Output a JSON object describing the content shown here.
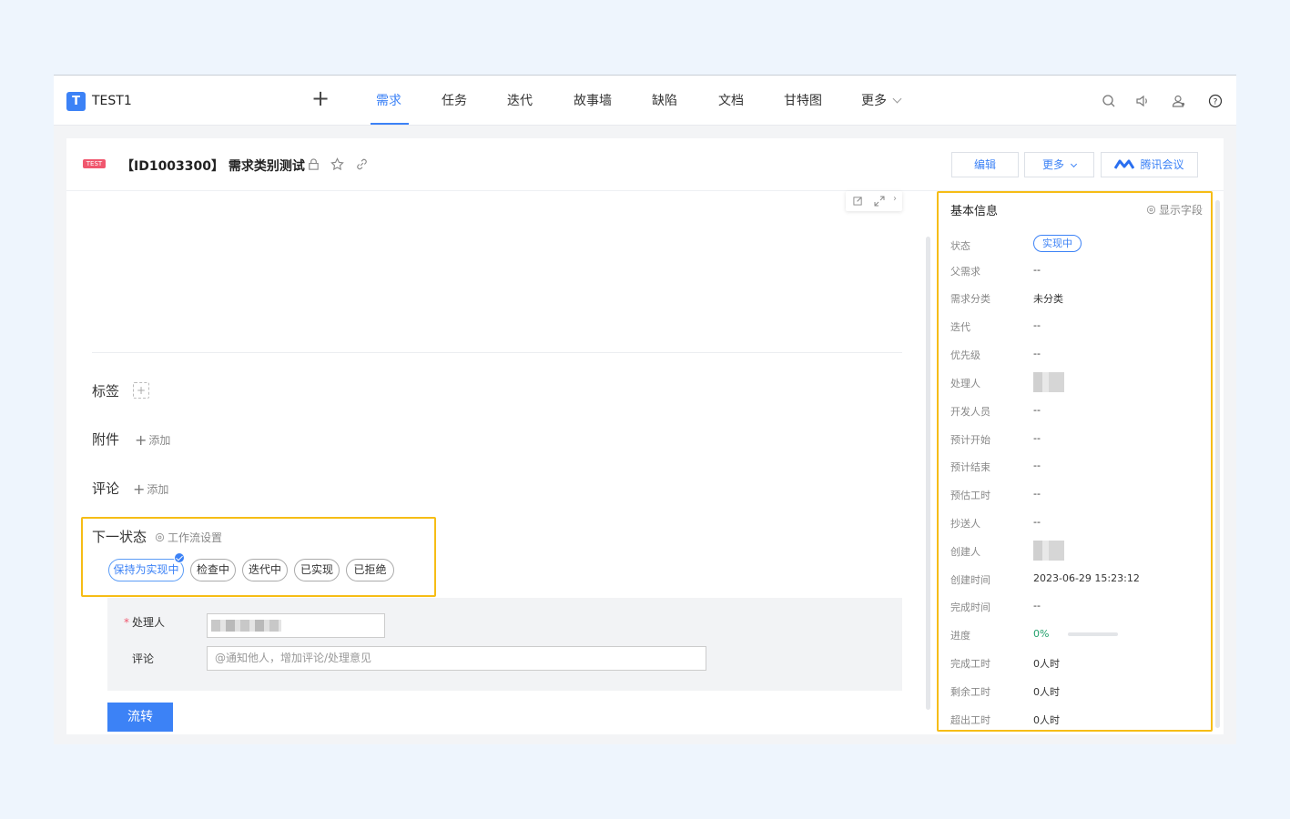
{
  "project": {
    "logo_letter": "T",
    "name": "TEST1"
  },
  "nav": {
    "add": "+",
    "items": [
      {
        "label": "需求",
        "active": true
      },
      {
        "label": "任务"
      },
      {
        "label": "迭代"
      },
      {
        "label": "故事墙"
      },
      {
        "label": "缺陷"
      },
      {
        "label": "文档"
      },
      {
        "label": "甘特图"
      },
      {
        "label": "更多"
      }
    ]
  },
  "toolbar_icons": [
    "search-icon",
    "speaker-icon",
    "user-icon",
    "help-icon"
  ],
  "detail": {
    "badge": "TEST",
    "title": "【ID1003300】 需求类别测试",
    "edit_btn": "编辑",
    "more_btn": "更多",
    "meeting_btn": "腾讯会议"
  },
  "sections": {
    "tags": "标签",
    "tags_add": "+",
    "attachments": "附件",
    "comments": "评论",
    "add": "添加"
  },
  "next_state": {
    "title": "下一状态",
    "workflow_setting": "工作流设置",
    "states": [
      "保持为实现中",
      "检查中",
      "迭代中",
      "已实现",
      "已拒绝"
    ],
    "selected_index": 0
  },
  "form": {
    "assignee_label": "处理人",
    "comment_label": "评论",
    "comment_placeholder": "@通知他人，增加评论/处理意见",
    "submit": "流转"
  },
  "side": {
    "title": "基本信息",
    "show_fields": "显示字段",
    "fields": [
      {
        "label": "状态",
        "value": "实现中",
        "type": "badge"
      },
      {
        "label": "父需求",
        "value": "--"
      },
      {
        "label": "需求分类",
        "value": "未分类"
      },
      {
        "label": "迭代",
        "value": "--"
      },
      {
        "label": "优先级",
        "value": "--"
      },
      {
        "label": "处理人",
        "value": "",
        "type": "avatar"
      },
      {
        "label": "开发人员",
        "value": "--"
      },
      {
        "label": "预计开始",
        "value": "--"
      },
      {
        "label": "预计结束",
        "value": "--"
      },
      {
        "label": "预估工时",
        "value": "--"
      },
      {
        "label": "抄送人",
        "value": "--"
      },
      {
        "label": "创建人",
        "value": "",
        "type": "avatar"
      },
      {
        "label": "创建时间",
        "value": "2023-06-29 15:23:12"
      },
      {
        "label": "完成时间",
        "value": "--"
      },
      {
        "label": "进度",
        "value": "0%",
        "type": "progress",
        "progress": 0
      },
      {
        "label": "完成工时",
        "value": "0人时"
      },
      {
        "label": "剩余工时",
        "value": "0人时"
      },
      {
        "label": "超出工时",
        "value": "0人时"
      }
    ]
  },
  "colors": {
    "accent": "#3c82f6",
    "highlight": "#f6bd16",
    "progress": "#22a06b",
    "badge": "#f0576e"
  }
}
